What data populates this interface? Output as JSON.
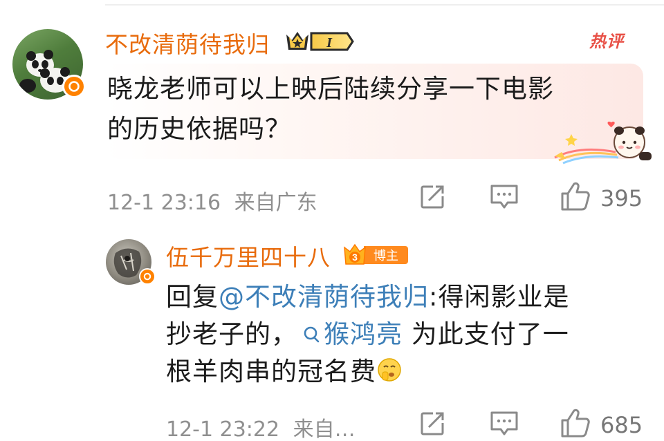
{
  "main_comment": {
    "username": "不改清荫待我归",
    "level_badge": "I",
    "hot_tag": "热评",
    "text_line1": "晓龙老师可以上映后陆续分享一下电影",
    "text_line2": "的历史依据吗？",
    "time": "12-1 23:16",
    "location": "来自广东",
    "like_count": "395"
  },
  "reply": {
    "username": "伍千万里四十八",
    "badge_number": "3",
    "badge_label": "博主",
    "prefix": "回复",
    "mention": "@不改清荫待我归",
    "after_mention": ":得闲影业是",
    "line2_start": "抄老子的，",
    "topic": "猴鸿亮",
    "line2_end": " 为此支付了一",
    "line3": "根羊肉串的冠名费",
    "time": "12-1 23:22",
    "location": "来自…",
    "like_count": "685"
  },
  "colors": {
    "username": "#e86b0c",
    "link": "#3d7fb8",
    "meta": "#8f8f8f",
    "verified_badge": "#ff8200",
    "hot_tag": "#e85248"
  },
  "icons": [
    "verified-badge-icon",
    "crown-level-icon",
    "repost-icon",
    "comment-icon",
    "like-icon",
    "search-topic-icon",
    "shush-emoji-icon",
    "panda-sticker"
  ]
}
